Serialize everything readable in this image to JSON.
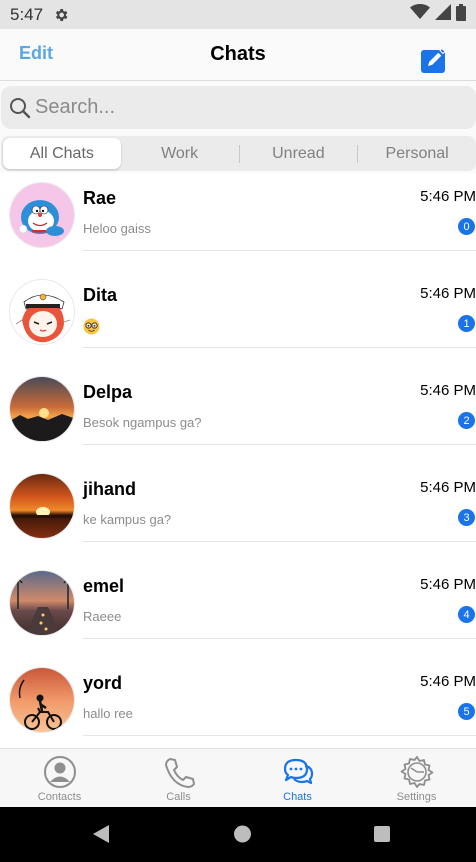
{
  "status_bar": {
    "time": "5:47",
    "icons": [
      "gear-icon",
      "wifi-icon",
      "signal-icon",
      "battery-icon"
    ]
  },
  "header": {
    "edit_label": "Edit",
    "title": "Chats",
    "compose_icon": "compose-icon"
  },
  "search": {
    "placeholder": "Search..."
  },
  "tabs": [
    {
      "label": "All Chats",
      "active": true
    },
    {
      "label": "Work",
      "active": false
    },
    {
      "label": "Unread",
      "active": false
    },
    {
      "label": "Personal",
      "active": false
    }
  ],
  "chats": [
    {
      "name": "Rae",
      "time": "5:46 PM",
      "preview": "Heloo gaiss",
      "badge": "0",
      "avatar": "doraemon-avatar"
    },
    {
      "name": "Dita",
      "time": "5:46 PM",
      "preview": "",
      "preview_icon": "nerd-face-emoji",
      "badge": "1",
      "avatar": "anime-sailor-avatar"
    },
    {
      "name": "Delpa",
      "time": "5:46 PM",
      "preview": "Besok ngampus ga?",
      "badge": "2",
      "avatar": "sunset-avatar"
    },
    {
      "name": "jihand",
      "time": "5:46 PM",
      "preview": "ke kampus ga?",
      "badge": "3",
      "avatar": "sunset-sea-avatar"
    },
    {
      "name": "emel",
      "time": "5:46 PM",
      "preview": "Raeee",
      "badge": "4",
      "avatar": "road-sunset-avatar"
    },
    {
      "name": "yord",
      "time": "5:46 PM",
      "preview": "hallo ree",
      "badge": "5",
      "avatar": "cyclist-silhouette-avatar"
    }
  ],
  "bottom_nav": [
    {
      "label": "Contacts",
      "icon": "contacts-icon",
      "active": false
    },
    {
      "label": "Calls",
      "icon": "phone-icon",
      "active": false
    },
    {
      "label": "Chats",
      "icon": "chat-bubbles-icon",
      "active": true
    },
    {
      "label": "Settings",
      "icon": "settings-gear-icon",
      "active": false
    }
  ],
  "colors": {
    "accent": "#1a73e8",
    "edit": "#5aa7e6",
    "status_bar": "#e4e4e4",
    "nav_bar": "#000000"
  }
}
